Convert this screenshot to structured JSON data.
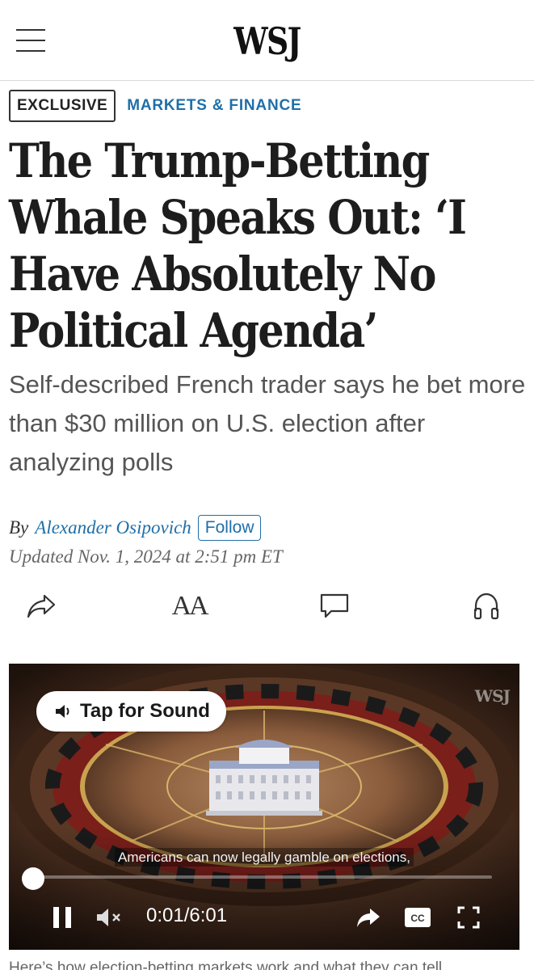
{
  "header": {
    "logo": "WSJ",
    "menu_icon": "hamburger-menu-icon"
  },
  "article": {
    "label": "EXCLUSIVE",
    "section": "MARKETS & FINANCE",
    "headline": "The Trump-Betting Whale Speaks Out: ‘I Have Absolutely No Political Agenda’",
    "subhead": "Self-described French trader says he bet more than $30 million on U.S. election after analyzing polls",
    "byline_prefix": "By",
    "author": "Alexander Osipovich",
    "follow_label": "Follow",
    "updated": "Updated Nov. 1, 2024 at 2:51 pm ET"
  },
  "tools": {
    "share_icon": "share-icon",
    "text_size_label": "AA",
    "comment_icon": "comment-icon",
    "listen_icon": "headphones-icon"
  },
  "video": {
    "sound_label": "Tap for Sound",
    "watermark": "WSJ",
    "caption": "Americans can now legally gamble on elections,",
    "current_time": "0:01",
    "duration": "6:01",
    "progress": 0.003,
    "muted": true
  },
  "below_text": "Here’s how election-betting markets work and what they can tell",
  "colors": {
    "accent_blue": "#1f6fa8",
    "headline": "#1d1d1d",
    "subhead": "#555555"
  }
}
